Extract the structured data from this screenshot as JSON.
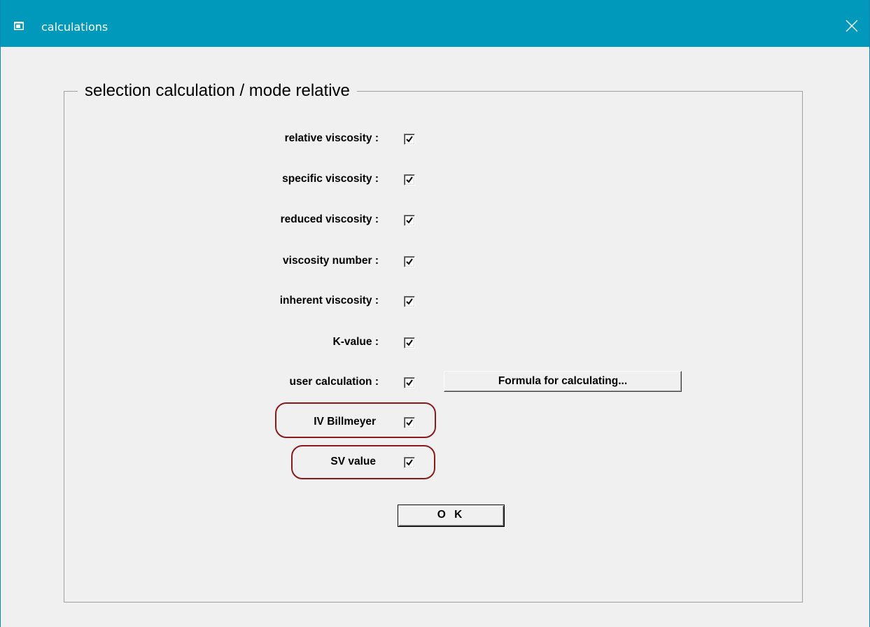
{
  "window": {
    "title": "calculations",
    "close_icon": "close-icon",
    "app_icon": "window-icon"
  },
  "group": {
    "legend": "selection calculation / mode relative"
  },
  "rows": [
    {
      "label": "relative viscosity :",
      "checked": true
    },
    {
      "label": "specific viscosity :",
      "checked": true
    },
    {
      "label": "reduced viscosity :",
      "checked": true
    },
    {
      "label": "viscosity number :",
      "checked": true
    },
    {
      "label": "inherent viscosity :",
      "checked": true
    },
    {
      "label": "K-value :",
      "checked": true
    },
    {
      "label": "user calculation :",
      "checked": true
    },
    {
      "label": "IV Billmeyer",
      "checked": true
    },
    {
      "label": "SV value",
      "checked": true
    }
  ],
  "buttons": {
    "formula": "Formula for calculating...",
    "ok": "O K"
  },
  "annotation_color": "#8b1a1a",
  "titlebar_color": "#0099bc"
}
